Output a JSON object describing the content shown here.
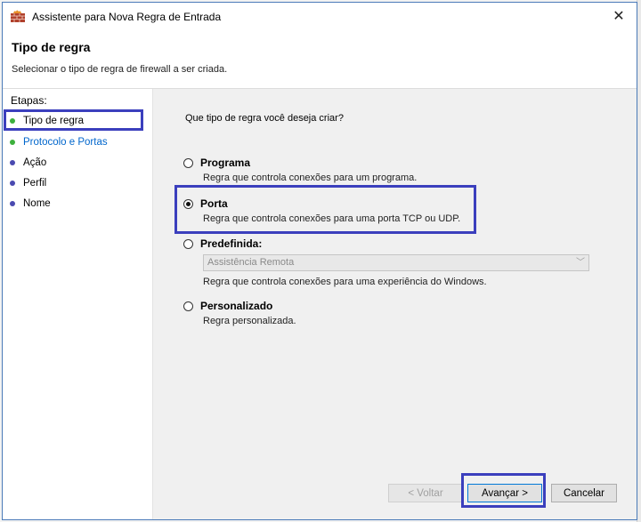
{
  "window": {
    "title": "Assistente para Nova Regra de Entrada",
    "close_glyph": "✕",
    "accent_color": "#3b3fbd"
  },
  "header": {
    "title": "Tipo de regra",
    "subtitle": "Selecionar o tipo de regra de firewall a ser criada."
  },
  "steps": {
    "heading": "Etapas:",
    "items": [
      {
        "label": "Tipo de regra",
        "dot_color": "#3db03d",
        "link": false
      },
      {
        "label": "Protocolo e Portas",
        "dot_color": "#3db03d",
        "link": true
      },
      {
        "label": "Ação",
        "dot_color": "#4a4ab0",
        "link": false
      },
      {
        "label": "Perfil",
        "dot_color": "#4a4ab0",
        "link": false
      },
      {
        "label": "Nome",
        "dot_color": "#4a4ab0",
        "link": false
      }
    ]
  },
  "main": {
    "question": "Que tipo de regra você deseja criar?",
    "options": [
      {
        "label": "Programa",
        "desc": "Regra que controla conexões para um programa.",
        "checked": false
      },
      {
        "label": "Porta",
        "desc": "Regra que controla conexões para uma porta TCP ou UDP.",
        "checked": true
      },
      {
        "label": "Predefinida:",
        "desc": "Regra que controla conexões para uma experiência do Windows.",
        "checked": false
      },
      {
        "label": "Personalizado",
        "desc": "Regra personalizada.",
        "checked": false
      }
    ],
    "predefined_select": {
      "value": "Assistência Remota",
      "chevron": "﹀"
    }
  },
  "buttons": {
    "back": "< Voltar",
    "next": "Avançar >",
    "cancel": "Cancelar"
  }
}
